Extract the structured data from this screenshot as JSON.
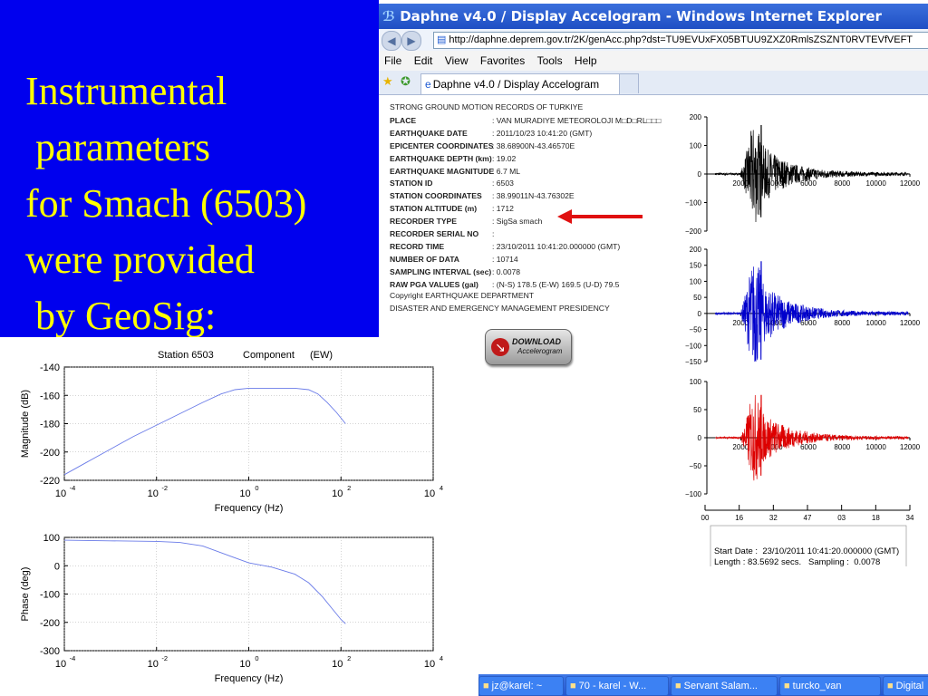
{
  "slide": {
    "title_lines": [
      "Instrumental",
      " parameters",
      "for Smach (6503)",
      "were provided",
      " by GeoSig:"
    ],
    "colors": {
      "background": "#0000ee",
      "title": "#ffff00"
    }
  },
  "browser": {
    "title": "Daphne v4.0 / Display Accelogram - Windows Internet Explorer",
    "url": "http://daphne.deprem.gov.tr/2K/genAcc.php?dst=TU9EVUxFX05BTUU9ZXZ0RmlsZSZNT0RVTEVfVEFT",
    "menu": [
      "File",
      "Edit",
      "View",
      "Favorites",
      "Tools",
      "Help"
    ],
    "tab_label": "Daphne v4.0 / Display Accelogram",
    "icons": {
      "back": "back-arrow-icon",
      "forward": "forward-arrow-icon",
      "page": "ie-page-icon",
      "favorites": "star-icon",
      "add_favorite": "add-favorite-icon"
    }
  },
  "record": {
    "header": "STRONG GROUND MOTION RECORDS OF TURKIYE",
    "fields": [
      {
        "key": "PLACE",
        "value": ": VAN MURADIYE METEOROLOJI M□D□RL□□□"
      },
      {
        "key": "EARTHQUAKE DATE",
        "value": ": 2011/10/23 10:41:20 (GMT)"
      },
      {
        "key": "EPICENTER COORDINATES",
        "value": ": 38.68900N-43.46570E"
      },
      {
        "key": "EARTHQUAKE DEPTH (km)",
        "value": ": 19.02"
      },
      {
        "key": "EARTHQUAKE MAGNITUDE",
        "value": ": 6.7 ML"
      },
      {
        "key": "STATION ID",
        "value": ": 6503"
      },
      {
        "key": "STATION COORDINATES",
        "value": ": 38.99011N-43.76302E"
      },
      {
        "key": "STATION ALTITUDE (m)",
        "value": ": 1712"
      },
      {
        "key": "RECORDER TYPE",
        "value": ": SigSa smach"
      },
      {
        "key": "RECORDER SERIAL NO",
        "value": ":"
      },
      {
        "key": "RECORD TIME",
        "value": ": 23/10/2011 10:41:20.000000 (GMT)"
      },
      {
        "key": "NUMBER OF DATA",
        "value": ": 10714"
      },
      {
        "key": "SAMPLING INTERVAL (sec)",
        "value": ": 0.0078"
      },
      {
        "key": "RAW PGA VALUES (gal)",
        "value": ": (N-S) 178.5 (E-W) 169.5 (U-D) 79.5"
      }
    ],
    "copyright_lines": [
      "Copyright EARTHQUAKE DEPARTMENT",
      "DISASTER AND EMERGENCY MANAGEMENT PRESIDENCY"
    ],
    "download": {
      "line1": "DOWNLOAD",
      "line2": "Accelerogram"
    },
    "footer_lines": [
      "Start Date :  23/10/2011 10:41:20.000000 (GMT)",
      "Length : 83.5692 secs.   Sampling :  0.0078"
    ],
    "arrow_color": "#e01010"
  },
  "chart_data": [
    {
      "type": "line",
      "title": "",
      "series": [
        {
          "name": "",
          "color": "#000000",
          "peak": 178.5
        }
      ],
      "x_ticks": [
        "2000",
        "4000",
        "6000",
        "8000",
        "10000",
        "12000"
      ],
      "y_ticks": [
        "200",
        "100",
        "0",
        "−100",
        "−200"
      ],
      "ylim": [
        -200,
        200
      ],
      "xlim": [
        0,
        12000
      ]
    },
    {
      "type": "line",
      "title": "",
      "series": [
        {
          "name": "",
          "color": "#0000cc",
          "peak": 169.5
        }
      ],
      "x_ticks": [
        "2000",
        "4000",
        "6000",
        "8000",
        "10000",
        "12000"
      ],
      "y_ticks": [
        "200",
        "150",
        "100",
        "50",
        "0",
        "−50",
        "−100",
        "−150"
      ],
      "ylim": [
        -150,
        200
      ],
      "xlim": [
        0,
        12000
      ]
    },
    {
      "type": "line",
      "title": "",
      "series": [
        {
          "name": "",
          "color": "#dd0000",
          "peak": 79.5
        }
      ],
      "x_ticks": [
        "2000",
        "4000",
        "6000",
        "8000",
        "10000",
        "12000"
      ],
      "y_ticks": [
        "100",
        "50",
        "0",
        "−50",
        "−100"
      ],
      "ylim": [
        -100,
        100
      ],
      "xlim": [
        0,
        12000
      ],
      "time_axis_ticks": [
        "00",
        "16",
        "32",
        "47",
        "03",
        "18",
        "34"
      ]
    },
    {
      "type": "line",
      "title_parts": [
        "Station 6503",
        "Component",
        "(EW)"
      ],
      "xlabel": "Frequency (Hz)",
      "ylabel": "Magnitude (dB)",
      "x_scale": "log",
      "x_ticks": [
        -4,
        -2,
        0,
        2,
        4
      ],
      "x_tick_base": "10",
      "y_ticks": [
        "-140",
        "-160",
        "-180",
        "-200",
        "-220"
      ],
      "ylim": [
        -220,
        -140
      ],
      "series": [
        {
          "name": "",
          "color": "#6a7be8",
          "x_log10": [
            -4.0,
            -3.5,
            -3.0,
            -2.5,
            -2.0,
            -1.5,
            -1.0,
            -0.6,
            -0.3,
            0.0,
            0.5,
            1.0,
            1.3,
            1.5,
            1.7,
            1.9,
            2.1
          ],
          "y": [
            -216,
            -207,
            -198,
            -189,
            -181,
            -173,
            -165,
            -159,
            -156,
            -155,
            -155,
            -155,
            -156,
            -159,
            -165,
            -172,
            -180
          ]
        }
      ]
    },
    {
      "type": "line",
      "xlabel": "Frequency (Hz)",
      "ylabel": "Phase (deg)",
      "x_scale": "log",
      "x_ticks": [
        -4,
        -2,
        0,
        2,
        4
      ],
      "x_tick_base": "10",
      "y_ticks": [
        "100",
        "0",
        "-100",
        "-200",
        "-300"
      ],
      "ylim": [
        -300,
        100
      ],
      "series": [
        {
          "name": "",
          "color": "#6a7be8",
          "x_log10": [
            -4.0,
            -3.0,
            -2.0,
            -1.5,
            -1.0,
            -0.5,
            0.0,
            0.5,
            1.0,
            1.3,
            1.6,
            1.8,
            2.0,
            2.1
          ],
          "y": [
            90,
            88,
            86,
            82,
            70,
            40,
            10,
            -5,
            -30,
            -60,
            -110,
            -150,
            -190,
            -205
          ]
        }
      ]
    }
  ],
  "taskbar": {
    "items": [
      {
        "label": "jz@karel: ~",
        "icon": "terminal-icon"
      },
      {
        "label": "70 - karel - W...",
        "icon": "folder-icon"
      },
      {
        "label": "Servant Salam...",
        "icon": "app-icon"
      },
      {
        "label": "turcko_van",
        "icon": "document-icon"
      },
      {
        "label": "Digital",
        "icon": "ie-icon"
      }
    ]
  }
}
